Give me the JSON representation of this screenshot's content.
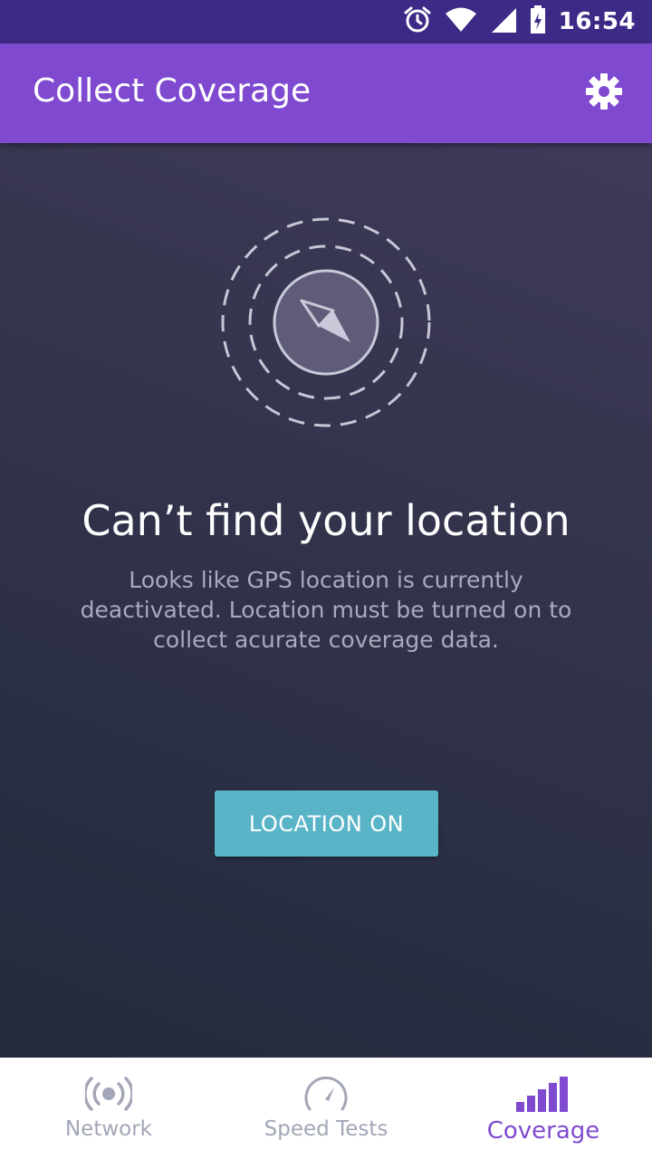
{
  "status_bar": {
    "time": "16:54",
    "icons": [
      "alarm-icon",
      "wifi-icon",
      "cell-signal-icon",
      "battery-charging-icon"
    ]
  },
  "app_bar": {
    "title": "Collect Coverage",
    "settings_icon": "gear-icon"
  },
  "main": {
    "illustration_icon": "compass-icon",
    "headline": "Can’t find your location",
    "message": "Looks like GPS location is currently deactivated. Location must be turned on to collect acurate coverage data.",
    "button_label": "LOCATION ON"
  },
  "bottom_nav": {
    "items": [
      {
        "label": "Network",
        "icon": "broadcast-icon",
        "active": false
      },
      {
        "label": "Speed Tests",
        "icon": "speedometer-icon",
        "active": false
      },
      {
        "label": "Coverage",
        "icon": "signal-bars-icon",
        "active": true
      }
    ]
  },
  "colors": {
    "status_bar": "#3d2a86",
    "app_bar": "#7f4ad0",
    "accent_button": "#5ab4c8",
    "active_nav": "#7f4ad0",
    "inactive_nav": "#a2a6b6"
  }
}
